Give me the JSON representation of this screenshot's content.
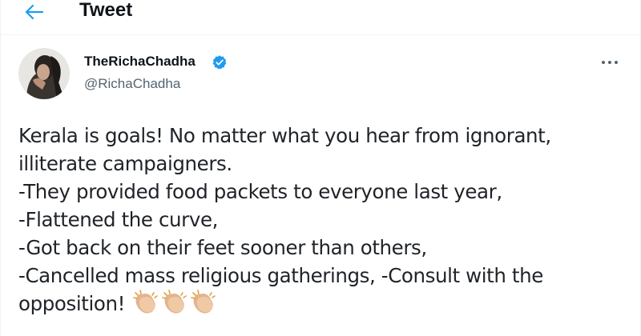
{
  "header": {
    "title": "Tweet",
    "back_icon": "arrow-left-icon",
    "accent_color": "#1d9bf0"
  },
  "author": {
    "display_name": "TheRichaChadha",
    "handle": "@RichaChadha",
    "verified": true,
    "verified_icon": "verified-badge-icon"
  },
  "menu": {
    "more_icon": "more-horizontal-icon"
  },
  "tweet": {
    "lines": [
      "Kerala is goals! No matter what you hear from ignorant,",
      "illiterate campaigners.",
      "-They provided food packets to everyone last year,",
      "-Flattened the curve,",
      "-Got back on their feet sooner than others,",
      "-Cancelled mass religious gatherings, -Consult with the",
      "opposition!"
    ],
    "emoji": [
      "clapping-hands-icon",
      "clapping-hands-icon",
      "clapping-hands-icon"
    ]
  }
}
